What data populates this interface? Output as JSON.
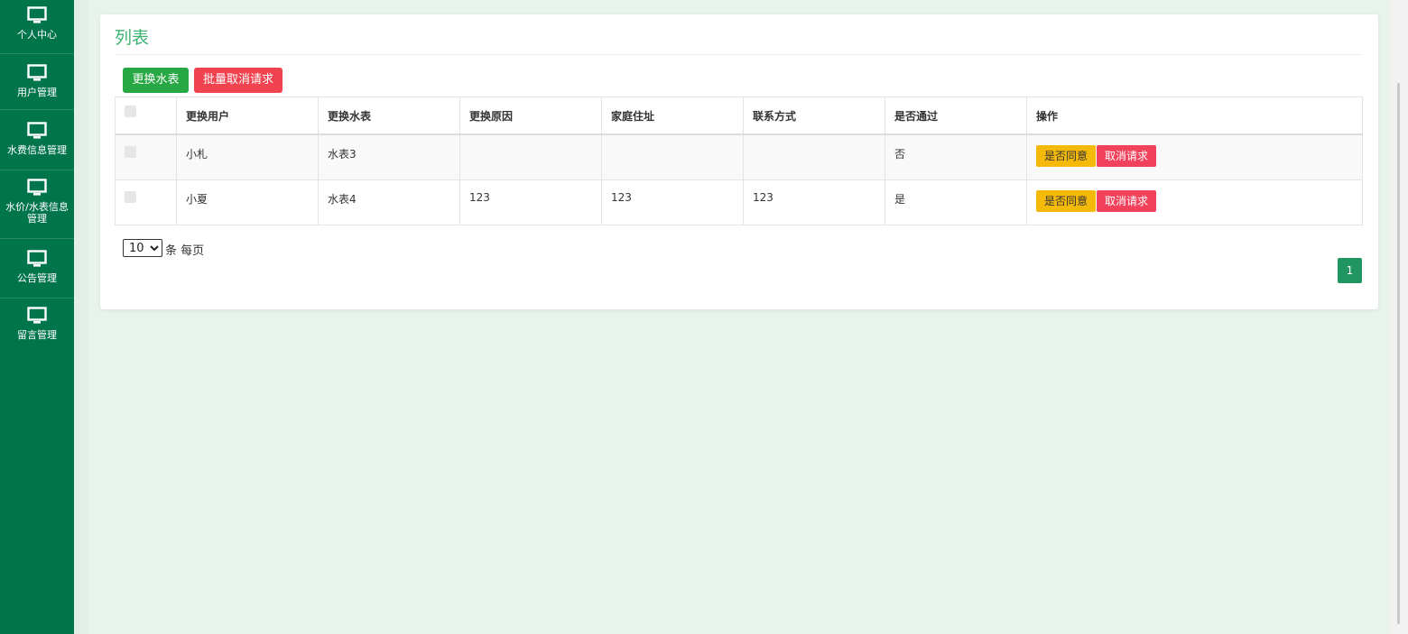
{
  "sidebar": {
    "items": [
      {
        "label": "个人中心",
        "icon": "monitor-icon"
      },
      {
        "label": "用户管理",
        "icon": "monitor-icon"
      },
      {
        "label": "水费信息管理",
        "icon": "monitor-icon"
      },
      {
        "label": "水价/水表信息管理",
        "icon": "monitor-icon"
      },
      {
        "label": "公告管理",
        "icon": "monitor-icon"
      },
      {
        "label": "留言管理",
        "icon": "monitor-icon"
      }
    ]
  },
  "panel": {
    "title": "列表",
    "toolbar": {
      "replace_label": "更换水表",
      "batch_cancel_label": "批量取消请求"
    },
    "table": {
      "headers": [
        "更换用户",
        "更换水表",
        "更换原因",
        "家庭住址",
        "联系方式",
        "是否通过",
        "操作"
      ],
      "rows": [
        {
          "user": "小札",
          "meter": "水表3",
          "reason": "",
          "address": "",
          "contact": "",
          "passed": "否",
          "approve_label": "是否同意",
          "cancel_label": "取消请求"
        },
        {
          "user": "小夏",
          "meter": "水表4",
          "reason": "123",
          "address": "123",
          "contact": "123",
          "passed": "是",
          "approve_label": "是否同意",
          "cancel_label": "取消请求"
        }
      ]
    },
    "pager": {
      "page_size": "10",
      "per_page_text": "条 每页",
      "current_page": "1"
    }
  },
  "colors": {
    "sidebar": "#00754b",
    "accent": "#28a745",
    "danger": "#f1434f",
    "warning": "#f5b90a",
    "title": "#3cb371"
  }
}
